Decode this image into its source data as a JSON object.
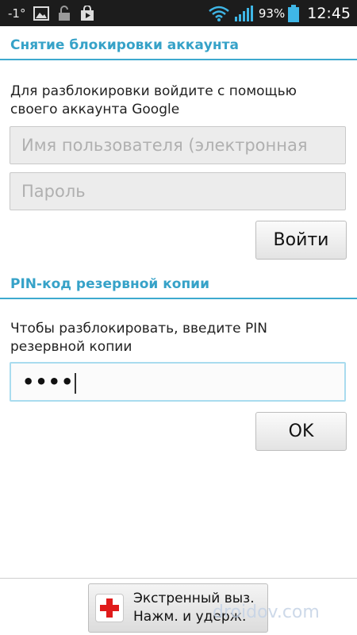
{
  "status_bar": {
    "temperature": "-1°",
    "battery_percent": "93%",
    "clock": "12:45",
    "icons": [
      "image-icon",
      "unlock-icon",
      "store-icon",
      "wifi-icon",
      "signal-icon",
      "battery-icon"
    ]
  },
  "account_unlock": {
    "header": "Снятие блокировки аккаунта",
    "description": "Для разблокировки войдите с помощью своего аккаунта Google",
    "username_placeholder": "Имя пользователя (электронная",
    "password_placeholder": "Пароль",
    "login_button": "Войти"
  },
  "pin_backup": {
    "header": "PIN-код резервной копии",
    "description": "Чтобы разблокировать, введите PIN резервной копии",
    "pin_value": "••••",
    "ok_button": "OK"
  },
  "emergency": {
    "line1": "Экстренный выз.",
    "line2": "Нажм. и удерж."
  },
  "watermark": "droidov.com",
  "colors": {
    "accent": "#36a2c8",
    "divider": "#3ea9cf",
    "emergency_cross": "#e01b1b"
  }
}
